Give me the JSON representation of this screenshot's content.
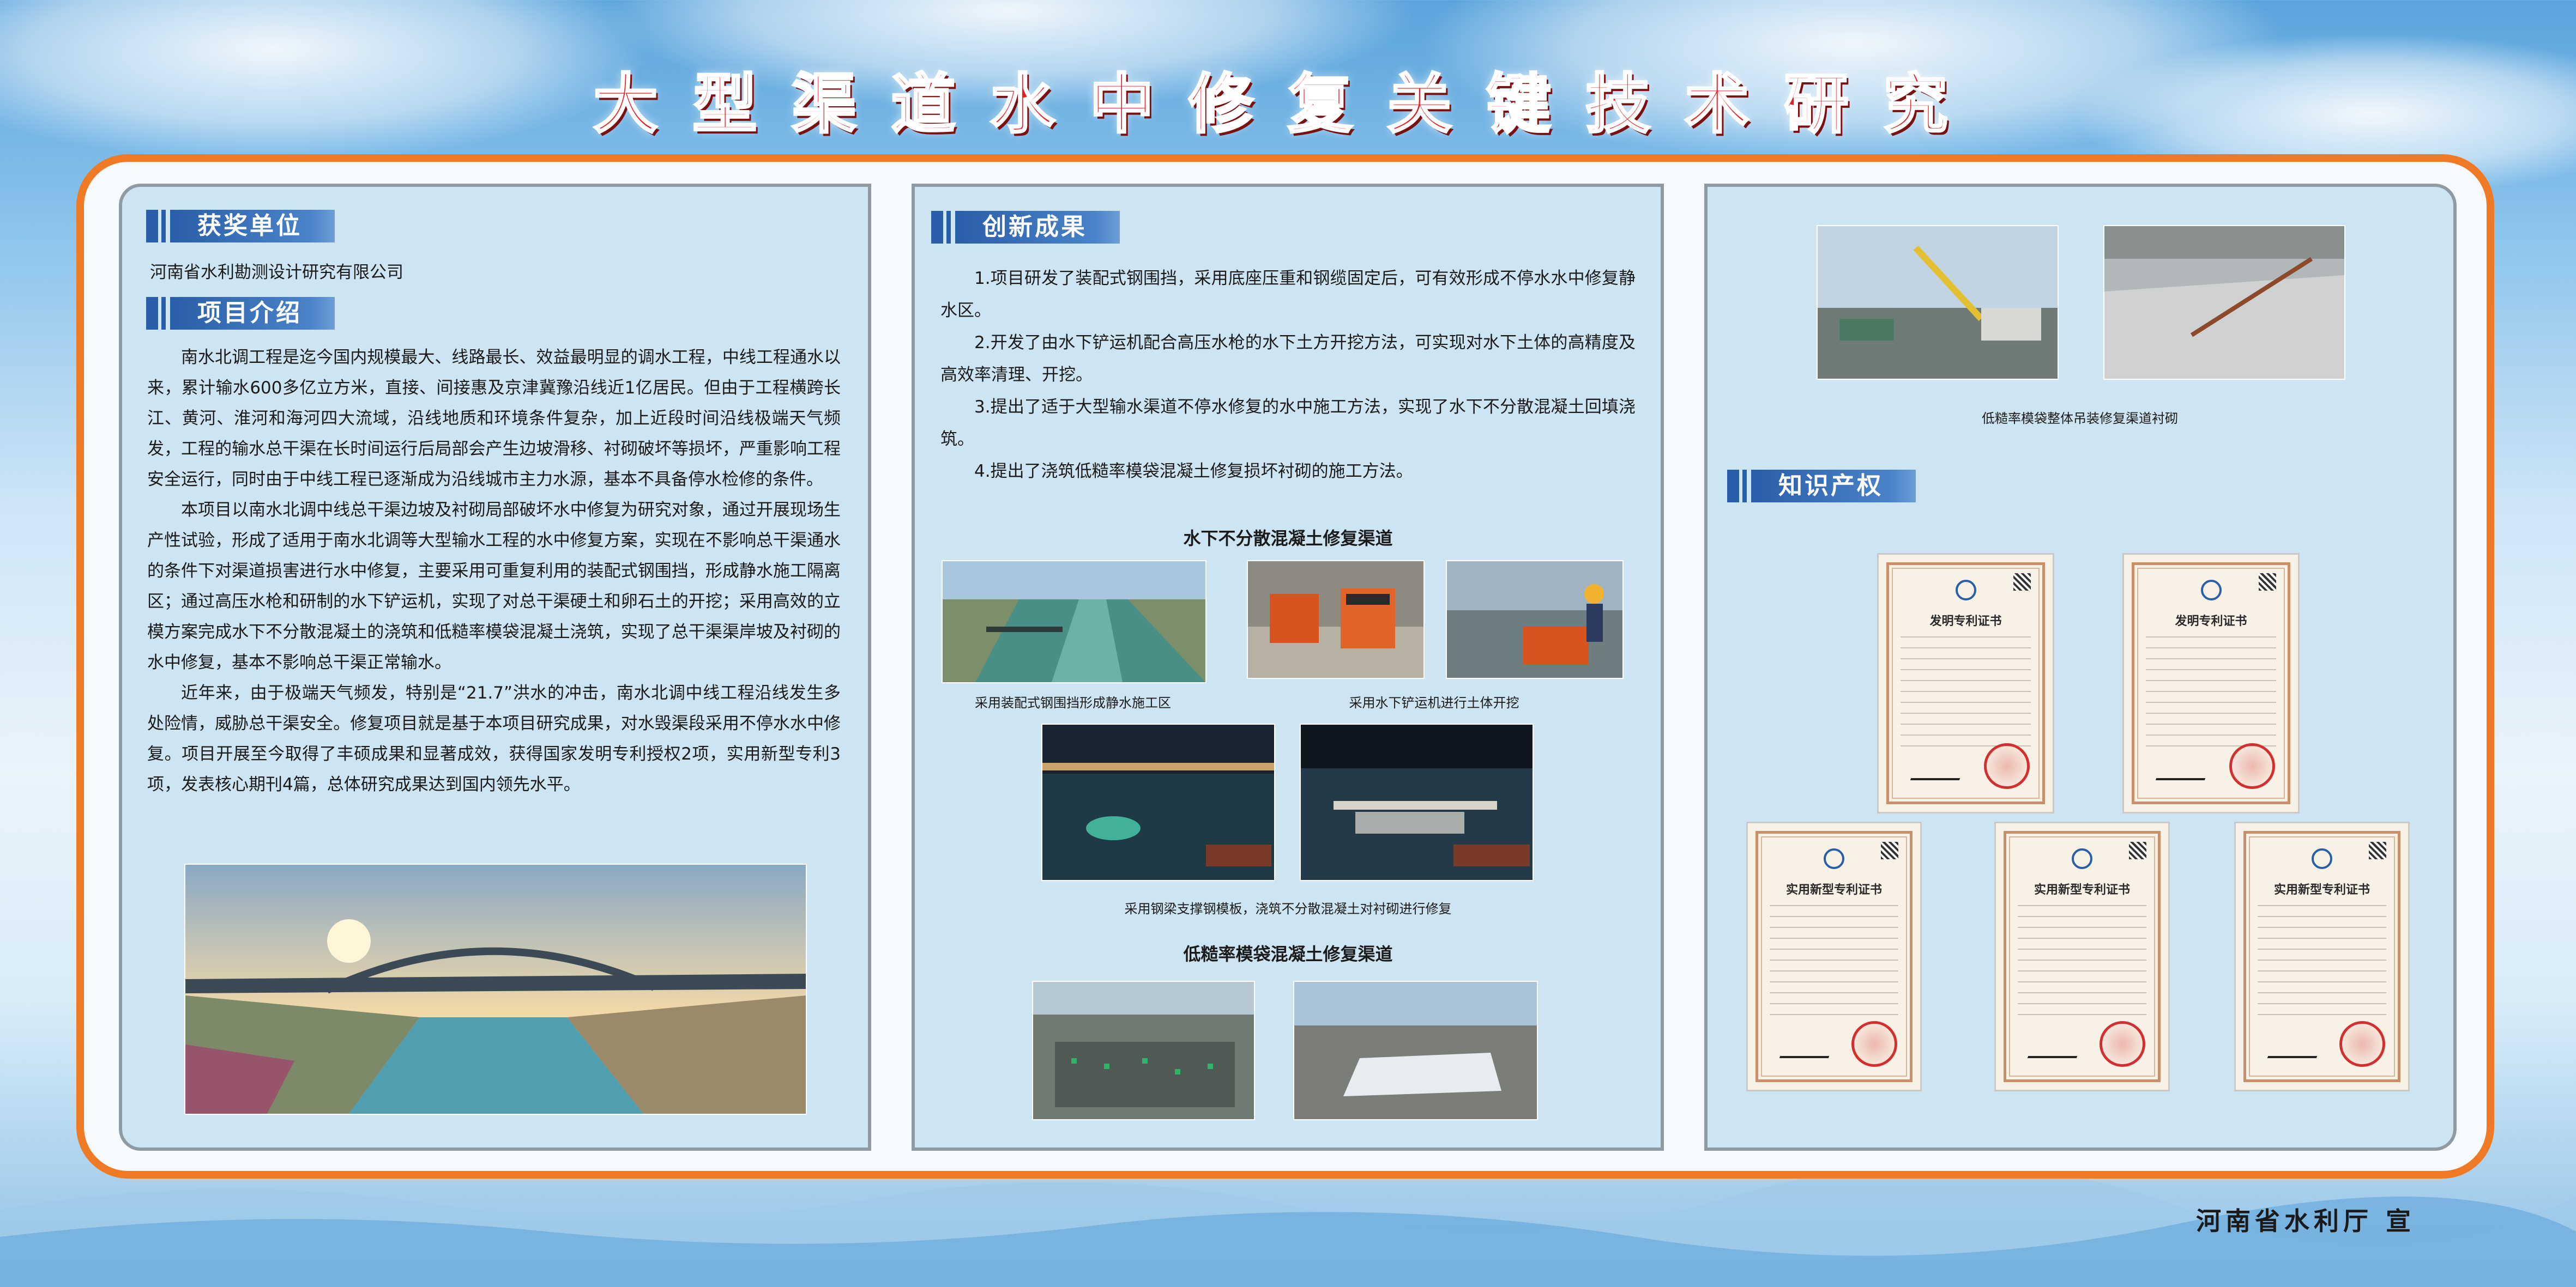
{
  "title": "大型渠道水中修复关键技术研究",
  "footer": "河南省水利厅  宣",
  "colors": {
    "frame": "#ee7a25",
    "section_header": "#2a5ea8",
    "title": "#e02020",
    "panel": "#cde4f2"
  },
  "panel1": {
    "award_heading": "获奖单位",
    "award_unit": "河南省水利勘测设计研究有限公司",
    "intro_heading": "项目介绍",
    "paragraphs": [
      "南水北调工程是迄今国内规模最大、线路最长、效益最明显的调水工程，中线工程通水以来，累计输水600多亿立方米，直接、间接惠及京津冀豫沿线近1亿居民。但由于工程横跨长江、黄河、淮河和海河四大流域，沿线地质和环境条件复杂，加上近段时间沿线极端天气频发，工程的输水总干渠在长时间运行后局部会产生边坡滑移、衬砌破坏等损坏，严重影响工程安全运行，同时由于中线工程已逐渐成为沿线城市主力水源，基本不具备停水检修的条件。",
      "本项目以南水北调中线总干渠边坡及衬砌局部破坏水中修复为研究对象，通过开展现场生产性试验，形成了适用于南水北调等大型输水工程的水中修复方案，实现在不影响总干渠通水的条件下对渠道损害进行水中修复，主要采用可重复利用的装配式钢围挡，形成静水施工隔离区；通过高压水枪和研制的水下铲运机，实现了对总干渠硬土和卵石土的开挖；采用高效的立模方案完成水下不分散混凝土的浇筑和低糙率模袋混凝土浇筑，实现了总干渠渠岸坡及衬砌的水中修复，基本不影响总干渠正常输水。",
      "近年来，由于极端天气频发，特别是“21.7”洪水的冲击，南水北调中线工程沿线发生多处险情，威胁总干渠安全。修复项目就是基于本项目研究成果，对水毁渠段采用不停水水中修复。项目开展至今取得了丰硕成果和显著成效，获得国家发明专利授权2项，实用新型专利3项，发表核心期刊4篇，总体研究成果达到国内领先水平。"
    ]
  },
  "panel2": {
    "heading": "创新成果",
    "items": [
      "1.项目研发了装配式钢围挡，采用底座压重和钢缆固定后，可有效形成不停水水中修复静水区。",
      "2.开发了由水下铲运机配合高压水枪的水下土方开挖方法，可实现对水下土体的高精度及高效率清理、开挖。",
      "3.提出了适于大型输水渠道不停水修复的水中施工方法，实现了水下不分散混凝土回填浇筑。",
      "4.提出了浇筑低糙率模袋混凝土修复损坏衬砌的施工方法。"
    ],
    "gallery1_title": "水下不分散混凝土修复渠道",
    "caption1": "采用装配式钢围挡形成静水施工区",
    "caption2": "采用水下铲运机进行土体开挖",
    "caption3": "采用钢梁支撑钢模板，浇筑不分散混凝土对衬砌进行修复",
    "gallery2_title": "低糙率模袋混凝土修复渠道"
  },
  "panel3": {
    "caption_top": "低糙率模袋整体吊装修复渠道衬砌",
    "ip_heading": "知识产权",
    "certs": [
      {
        "title": "发明专利证书"
      },
      {
        "title": "发明专利证书"
      },
      {
        "title": "实用新型专利证书"
      },
      {
        "title": "实用新型专利证书"
      },
      {
        "title": "实用新型专利证书"
      }
    ]
  }
}
